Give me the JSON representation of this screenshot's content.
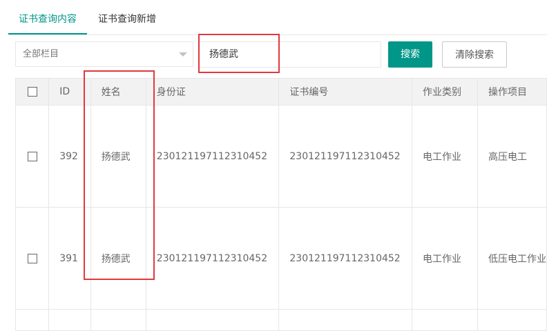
{
  "tabs": [
    {
      "label": "证书查询内容",
      "active": true
    },
    {
      "label": "证书查询新增",
      "active": false
    }
  ],
  "filter": {
    "category_select": "全部栏目",
    "search_value": "扬德武",
    "search_button": "搜索",
    "clear_button": "清除搜索"
  },
  "table": {
    "columns": [
      "ID",
      "姓名",
      "身份证",
      "证书编号",
      "作业类别",
      "操作项目"
    ],
    "rows": [
      {
        "id": "392",
        "name": "扬德武",
        "id_card": "230121197112310452",
        "cert_no": "230121197112310452",
        "work_type": "电工作业",
        "operation": "高压电工"
      },
      {
        "id": "391",
        "name": "扬德武",
        "id_card": "230121197112310452",
        "cert_no": "230121197112310452",
        "work_type": "电工作业",
        "operation": "低压电工作业"
      }
    ]
  },
  "colors": {
    "accent": "#009688",
    "highlight": "#e0383e"
  }
}
